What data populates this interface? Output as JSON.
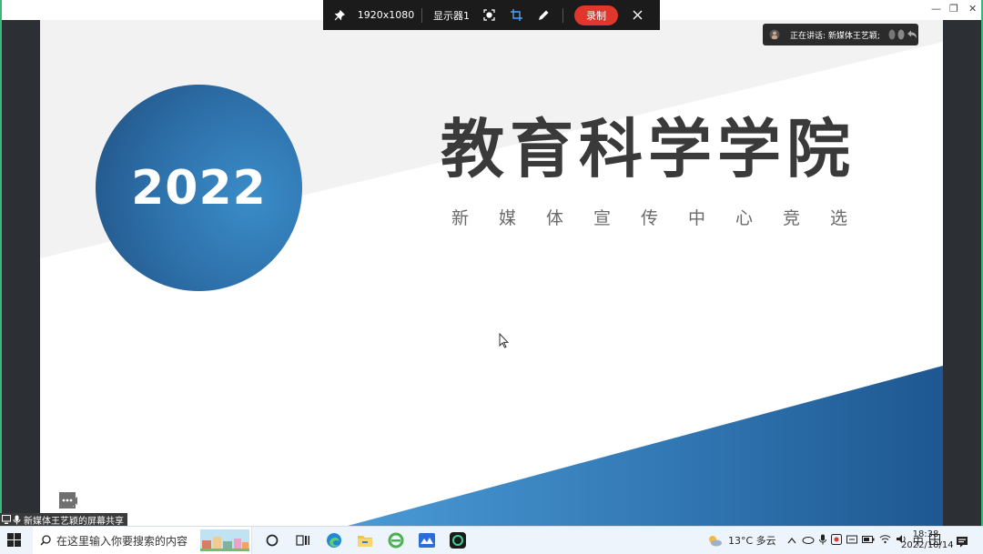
{
  "slide": {
    "year": "2022",
    "title": "教育科学学院",
    "subtitle": "新媒体宣传中心竞选",
    "accent_color": "#2f73ad"
  },
  "share_toolbar": {
    "resolution": "1920x1080",
    "display": "显示器1",
    "record_label": "录制"
  },
  "speaking_indicator": {
    "text": "正在讲话: 新媒体王艺颖;"
  },
  "share_label": "新媒体王艺颖的屏幕共享",
  "taskbar": {
    "search_placeholder": "在这里输入你要搜索的内容",
    "weather": "13°C  多云",
    "ime": "中",
    "time": "18:38",
    "date": "2022/10/14"
  }
}
